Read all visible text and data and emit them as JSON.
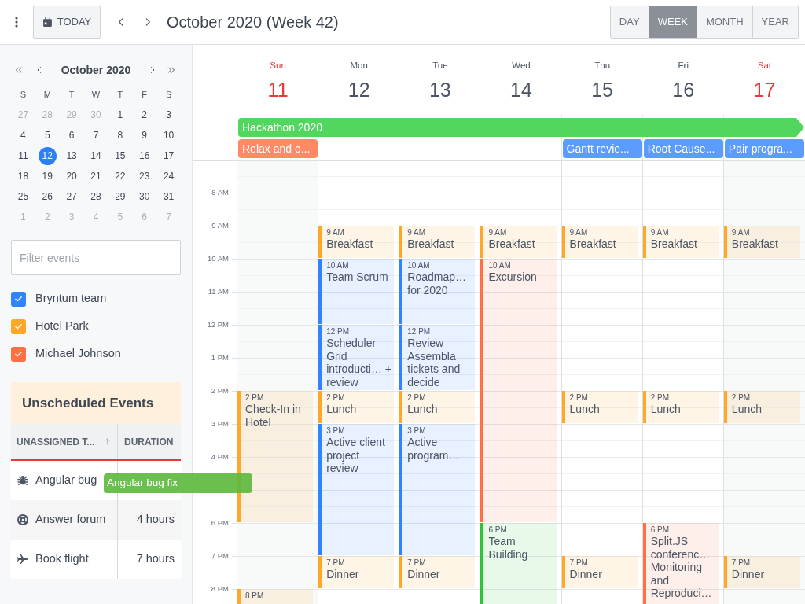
{
  "toolbar": {
    "today_button": "TODAY",
    "title": "October 2020 (Week 42)",
    "views": [
      {
        "label": "DAY",
        "selected": false
      },
      {
        "label": "WEEK",
        "selected": true
      },
      {
        "label": "MONTH",
        "selected": false
      },
      {
        "label": "YEAR",
        "selected": false
      }
    ]
  },
  "mini_calendar": {
    "title": "October 2020",
    "weekdays": [
      "S",
      "M",
      "T",
      "W",
      "T",
      "F",
      "S"
    ],
    "weeks": [
      [
        {
          "label": "27",
          "outside": true,
          "selected": false
        },
        {
          "label": "28",
          "outside": true,
          "selected": false
        },
        {
          "label": "29",
          "outside": true,
          "selected": false
        },
        {
          "label": "30",
          "outside": true,
          "selected": false
        },
        {
          "label": "1",
          "outside": false,
          "selected": false
        },
        {
          "label": "2",
          "outside": false,
          "selected": false
        },
        {
          "label": "3",
          "outside": false,
          "selected": false
        }
      ],
      [
        {
          "label": "4",
          "outside": false,
          "selected": false
        },
        {
          "label": "5",
          "outside": false,
          "selected": false
        },
        {
          "label": "6",
          "outside": false,
          "selected": false
        },
        {
          "label": "7",
          "outside": false,
          "selected": false
        },
        {
          "label": "8",
          "outside": false,
          "selected": false
        },
        {
          "label": "9",
          "outside": false,
          "selected": false
        },
        {
          "label": "10",
          "outside": false,
          "selected": false
        }
      ],
      [
        {
          "label": "11",
          "outside": false,
          "selected": false
        },
        {
          "label": "12",
          "outside": false,
          "selected": true
        },
        {
          "label": "13",
          "outside": false,
          "selected": false
        },
        {
          "label": "14",
          "outside": false,
          "selected": false
        },
        {
          "label": "15",
          "outside": false,
          "selected": false
        },
        {
          "label": "16",
          "outside": false,
          "selected": false
        },
        {
          "label": "17",
          "outside": false,
          "selected": false
        }
      ],
      [
        {
          "label": "18",
          "outside": false,
          "selected": false
        },
        {
          "label": "19",
          "outside": false,
          "selected": false
        },
        {
          "label": "20",
          "outside": false,
          "selected": false
        },
        {
          "label": "21",
          "outside": false,
          "selected": false
        },
        {
          "label": "22",
          "outside": false,
          "selected": false
        },
        {
          "label": "23",
          "outside": false,
          "selected": false
        },
        {
          "label": "24",
          "outside": false,
          "selected": false
        }
      ],
      [
        {
          "label": "25",
          "outside": false,
          "selected": false
        },
        {
          "label": "26",
          "outside": false,
          "selected": false
        },
        {
          "label": "27",
          "outside": false,
          "selected": false
        },
        {
          "label": "28",
          "outside": false,
          "selected": false
        },
        {
          "label": "29",
          "outside": false,
          "selected": false
        },
        {
          "label": "30",
          "outside": false,
          "selected": false
        },
        {
          "label": "31",
          "outside": false,
          "selected": false
        }
      ],
      [
        {
          "label": "1",
          "outside": true,
          "selected": false
        },
        {
          "label": "2",
          "outside": true,
          "selected": false
        },
        {
          "label": "3",
          "outside": true,
          "selected": false
        },
        {
          "label": "4",
          "outside": true,
          "selected": false
        },
        {
          "label": "5",
          "outside": true,
          "selected": false
        },
        {
          "label": "6",
          "outside": true,
          "selected": false
        },
        {
          "label": "7",
          "outside": true,
          "selected": false
        }
      ]
    ]
  },
  "filter": {
    "placeholder": "Filter events"
  },
  "resources": [
    {
      "label": "Bryntum team",
      "checked": true,
      "color": "#3183fe"
    },
    {
      "label": "Hotel Park",
      "checked": true,
      "color": "#ffa726"
    },
    {
      "label": "Michael Johnson",
      "checked": true,
      "color": "#ff7043"
    }
  ],
  "unscheduled": {
    "title": "Unscheduled Events",
    "columns": [
      "UNASSIGNED T...",
      "DURATION"
    ],
    "rows": [
      {
        "kind": "bug",
        "name": "Angular bug"
      },
      {
        "kind": "lifebuoy",
        "name": "Answer forum",
        "duration": "4 hours"
      },
      {
        "kind": "plane",
        "name": "Book flight",
        "duration": "7 hours"
      }
    ]
  },
  "drag_proxy": {
    "title": "Angular bug fix"
  },
  "time_labels": [
    "8 AM",
    "9 AM",
    "10 AM",
    "11 AM",
    "12 PM",
    "1 PM",
    "2 PM",
    "3 PM",
    "4 PM",
    "6 PM",
    "7 PM",
    "8 PM"
  ],
  "multi_day_event": {
    "title": "Hackathon 2020",
    "color": "#52d65e"
  },
  "days": [
    {
      "weekday": "Sun",
      "date": "11",
      "weekend": true,
      "all_day_event": {
        "title": "Relax and o...",
        "color": "#ff8a65"
      },
      "events": [
        {
          "time": "2 PM",
          "title": "Check-In in Hotel",
          "color": "#ffa726"
        },
        {
          "time": "8 PM",
          "color": "#ffa726"
        }
      ]
    },
    {
      "weekday": "Mon",
      "date": "12",
      "weekend": false,
      "events": [
        {
          "time": "9 AM",
          "title": "Breakfast",
          "color": "#ffa726"
        },
        {
          "time": "10 AM",
          "title": "Team Scrum",
          "color": "#3183fe"
        },
        {
          "time": "12 PM",
          "title": "Scheduler Grid introducti… + review",
          "color": "#3183fe"
        },
        {
          "time": "2 PM",
          "title": "Lunch",
          "color": "#ffa726"
        },
        {
          "time": "3 PM",
          "title": "Active client project review",
          "color": "#3183fe"
        },
        {
          "time": "7 PM",
          "title": "Dinner",
          "color": "#ffa726"
        }
      ]
    },
    {
      "weekday": "Tue",
      "date": "13",
      "weekend": false,
      "events": [
        {
          "time": "9 AM",
          "title": "Breakfast",
          "color": "#ffa726"
        },
        {
          "time": "10 AM",
          "title": "Roadmap… for 2020",
          "color": "#3183fe"
        },
        {
          "time": "12 PM",
          "title": "Review Assembla tickets and decide",
          "color": "#3183fe"
        },
        {
          "time": "2 PM",
          "title": "Lunch",
          "color": "#ffa726"
        },
        {
          "time": "3 PM",
          "title": "Active program…",
          "color": "#3183fe"
        },
        {
          "time": "7 PM",
          "title": "Dinner",
          "color": "#ffa726"
        }
      ]
    },
    {
      "weekday": "Wed",
      "date": "14",
      "weekend": false,
      "events": [
        {
          "time": "9 AM",
          "title": "Breakfast",
          "color": "#ffa726"
        },
        {
          "time": "10 AM",
          "title": "Excursion",
          "color": "#ff7043"
        },
        {
          "time": "6 PM",
          "title": "Team Building",
          "color": "#2fc435"
        }
      ]
    },
    {
      "weekday": "Thu",
      "date": "15",
      "weekend": false,
      "all_day_event": {
        "title": "Gantt revie...",
        "color": "#5c9cff"
      },
      "events": [
        {
          "time": "9 AM",
          "title": "Breakfast",
          "color": "#ffa726"
        },
        {
          "time": "2 PM",
          "title": "Lunch",
          "color": "#ffa726"
        },
        {
          "time": "7 PM",
          "title": "Dinner",
          "color": "#ffa726"
        }
      ]
    },
    {
      "weekday": "Fri",
      "date": "16",
      "weekend": false,
      "all_day_event": {
        "title": "Root Cause...",
        "color": "#5c9cff"
      },
      "events": [
        {
          "time": "9 AM",
          "title": "Breakfast",
          "color": "#ffa726"
        },
        {
          "time": "2 PM",
          "title": "Lunch",
          "color": "#ffa726"
        },
        {
          "time": "6 PM",
          "title": "Split.JS conferenc… Monitoring and Reproduci…",
          "color": "#ff7043"
        }
      ]
    },
    {
      "weekday": "Sat",
      "date": "17",
      "weekend": true,
      "all_day_event": {
        "title": "Pair progra...",
        "color": "#5c9cff"
      },
      "events": [
        {
          "time": "9 AM",
          "title": "Breakfast",
          "color": "#ffa726"
        },
        {
          "time": "2 PM",
          "title": "Lunch",
          "color": "#ffa726"
        },
        {
          "time": "7 PM",
          "title": "Dinner",
          "color": "#ffa726"
        }
      ]
    }
  ]
}
